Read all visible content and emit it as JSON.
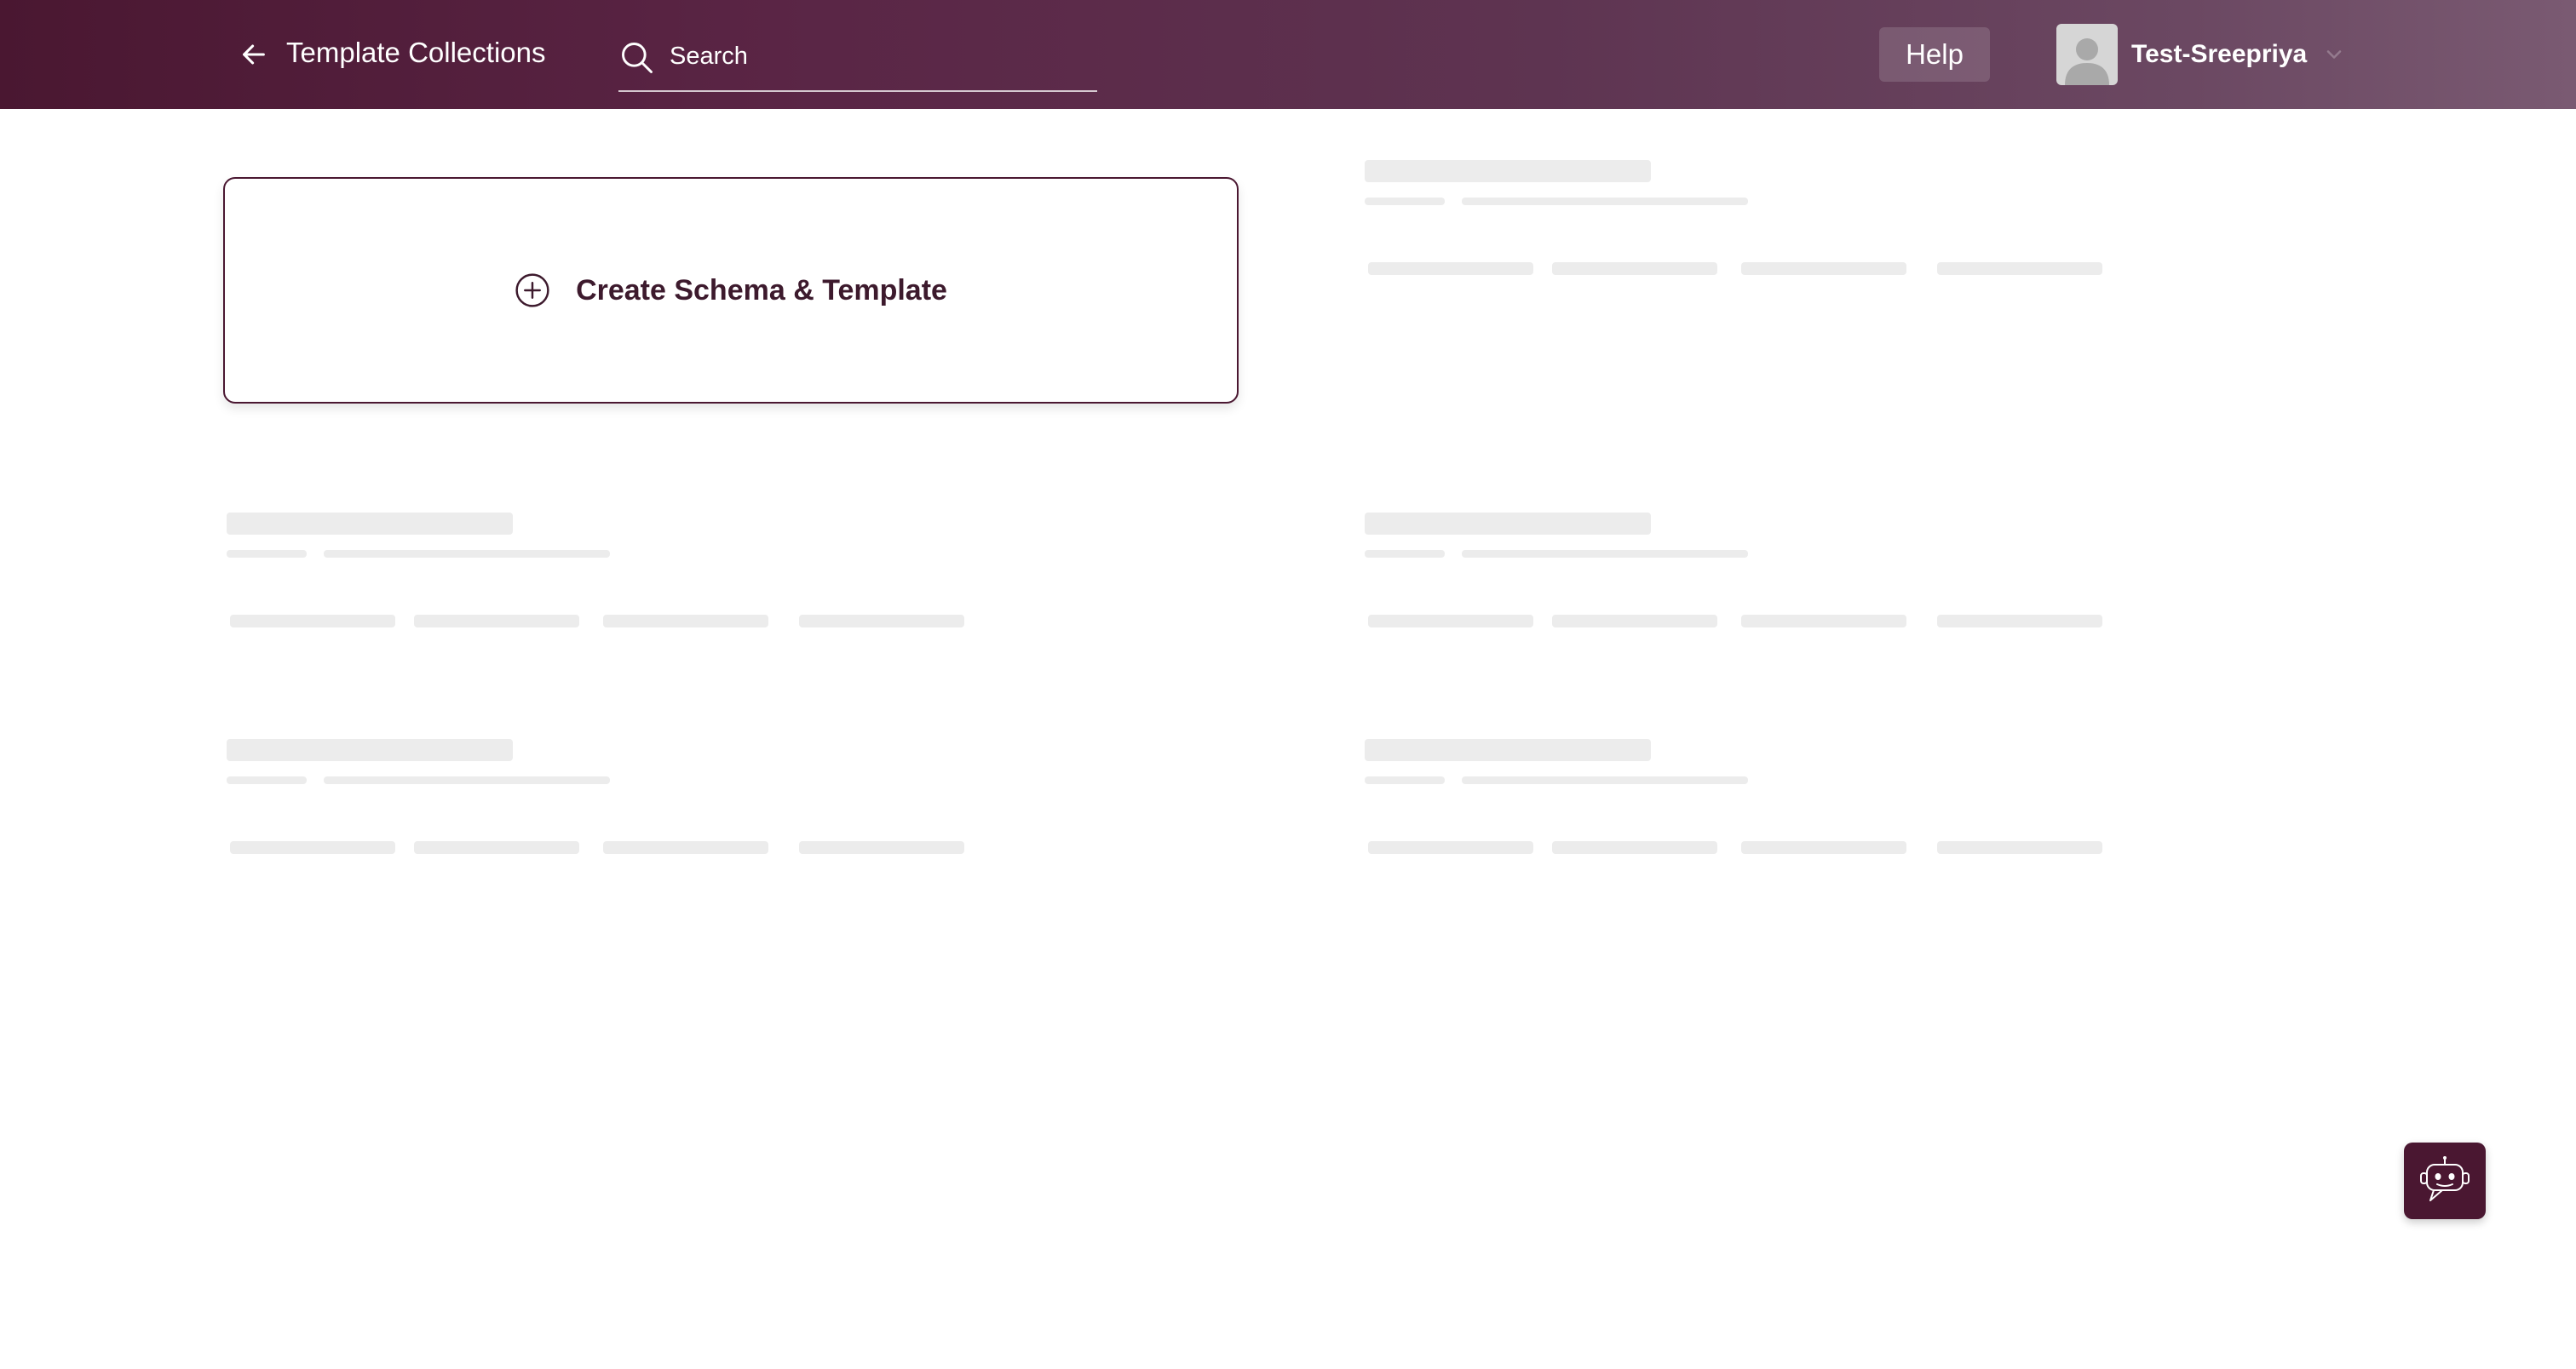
{
  "header": {
    "back_icon": "arrow-left-icon",
    "title": "Template Collections",
    "search": {
      "placeholder": "Search",
      "value": "",
      "icon": "search-icon"
    },
    "help_label": "Help",
    "user": {
      "name": "Test-Sreepriya",
      "avatar_icon": "user-avatar-icon",
      "menu_icon": "chevron-down-icon"
    }
  },
  "main": {
    "create_card": {
      "label": "Create Schema & Template",
      "icon": "plus-circle-icon"
    },
    "loading_cards": 5
  },
  "chatbot": {
    "icon": "chatbot-icon"
  },
  "colors": {
    "header_start": "#4a1731",
    "header_end": "#7a5a72",
    "accent": "#4a1731",
    "skeleton": "#ececec",
    "text_primary": "#3d1a2d"
  }
}
